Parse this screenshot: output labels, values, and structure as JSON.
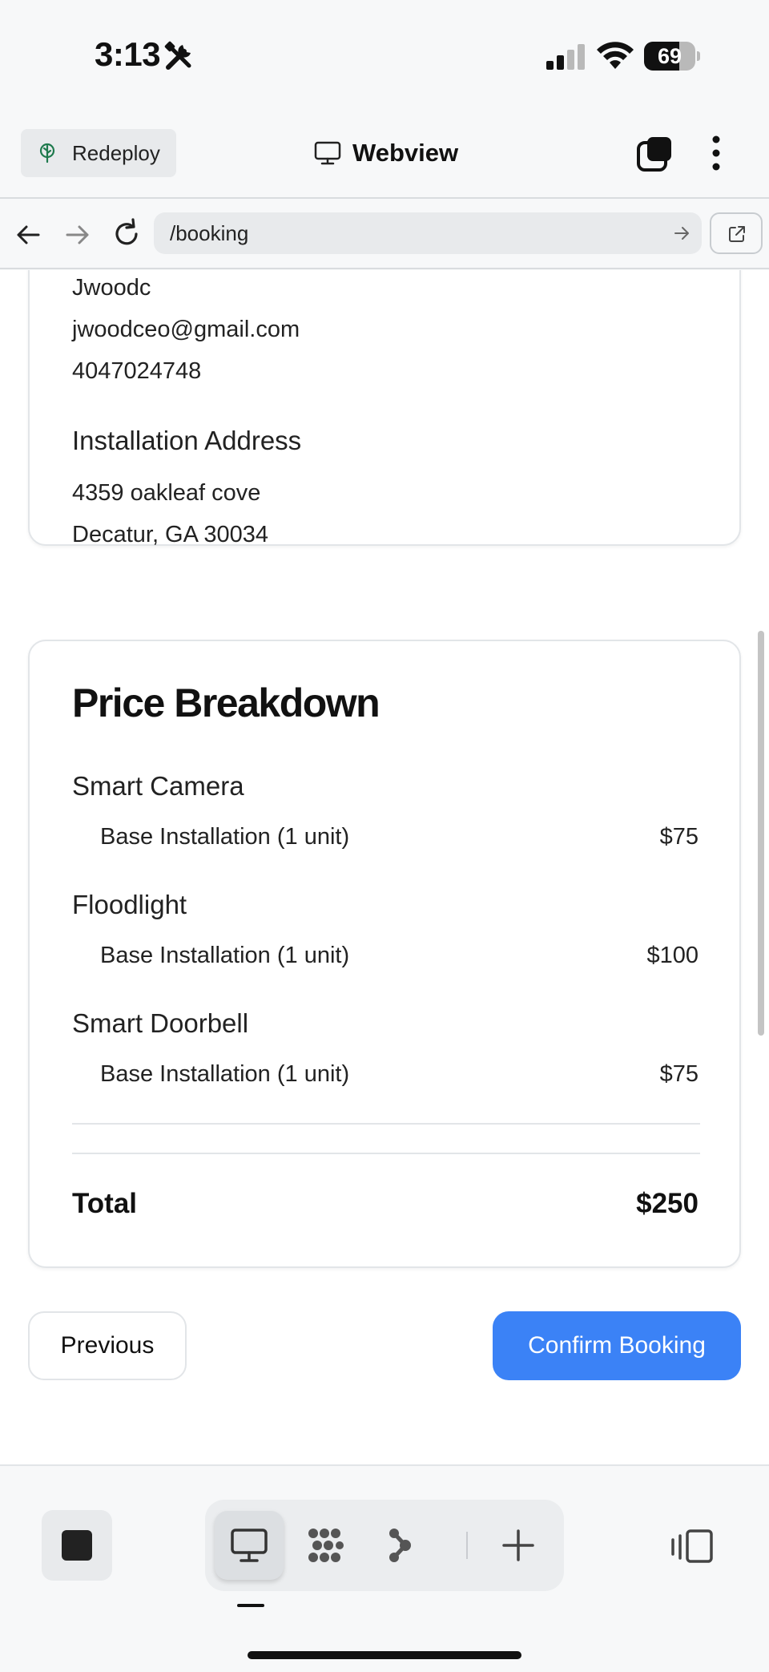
{
  "status_bar": {
    "time": "3:13",
    "battery_percent": "69",
    "battery_level": 0.69
  },
  "header": {
    "redeploy_label": "Redeploy",
    "title": "Webview"
  },
  "url_bar": {
    "url": "/booking"
  },
  "contact": {
    "name": "Jwoodc",
    "email": "jwoodceo@gmail.com",
    "phone": "4047024748",
    "address_heading": "Installation Address",
    "address_line1": "4359 oakleaf cove",
    "address_line2": "Decatur, GA 30034"
  },
  "price_breakdown": {
    "title": "Price Breakdown",
    "groups": [
      {
        "name": "Smart Camera",
        "item": "Base Installation (1 unit)",
        "price": "$75"
      },
      {
        "name": "Floodlight",
        "item": "Base Installation (1 unit)",
        "price": "$100"
      },
      {
        "name": "Smart Doorbell",
        "item": "Base Installation (1 unit)",
        "price": "$75"
      }
    ],
    "total_label": "Total",
    "total_value": "$250"
  },
  "actions": {
    "previous_label": "Previous",
    "confirm_label": "Confirm Booking"
  },
  "icons": {
    "status": [
      "tools-icon",
      "signal-icon",
      "wifi-icon",
      "battery-icon"
    ],
    "header": [
      "tree-icon",
      "monitor-icon",
      "tabs-icon",
      "more-vertical-icon"
    ],
    "nav": [
      "arrow-left-icon",
      "arrow-right-icon",
      "reload-icon",
      "arrow-right-small-icon",
      "external-link-icon"
    ],
    "toolbar": [
      "stop-icon",
      "monitor-icon",
      "dots-grid-icon",
      "branch-icon",
      "plus-icon",
      "devices-icon"
    ]
  },
  "colors": {
    "accent": "#3b82f6",
    "background": "#f7f8f9",
    "card_border": "#e2e5e8"
  }
}
